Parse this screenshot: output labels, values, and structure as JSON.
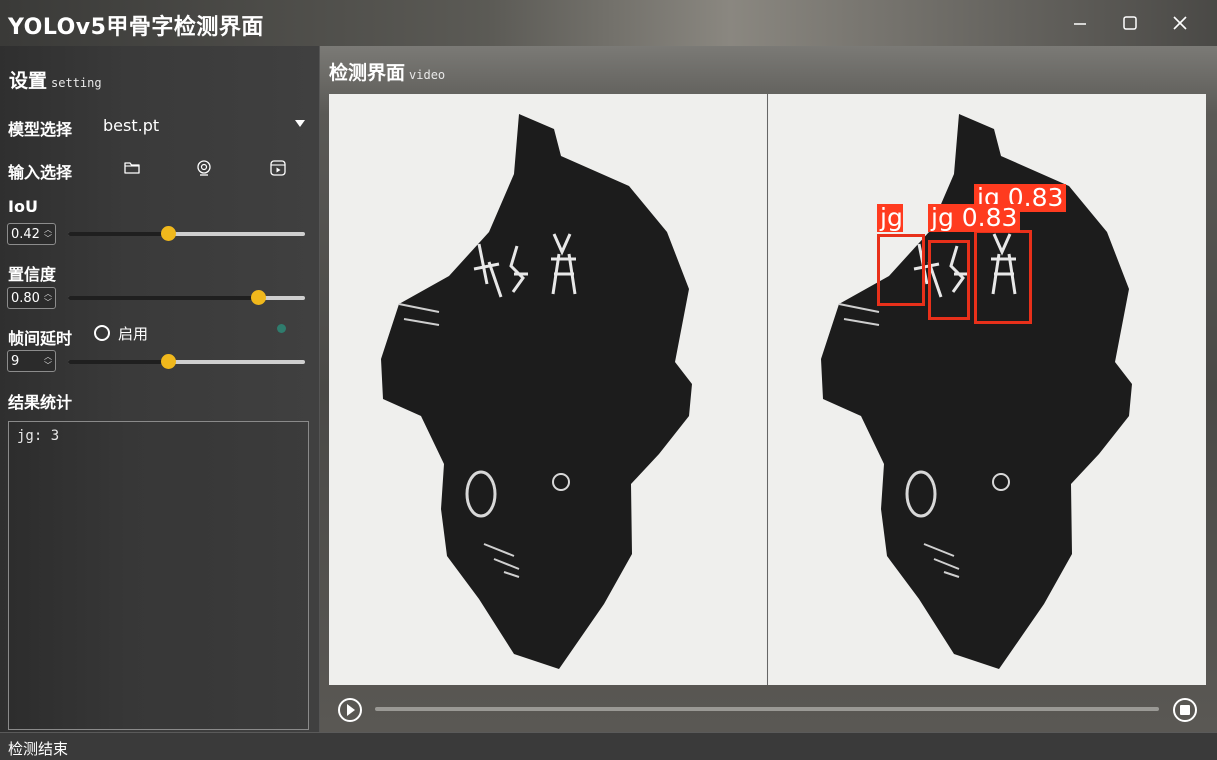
{
  "window": {
    "title": "YOLOv5甲骨字检测界面"
  },
  "settings": {
    "title": "设置",
    "subtitle": "setting",
    "model_label": "模型选择",
    "model_value": "best.pt",
    "input_label": "输入选择",
    "input_icons": [
      "folder-icon",
      "webcam-icon",
      "video-file-icon"
    ],
    "iou_label": "IoU",
    "iou_value": "0.42",
    "iou_level": 0.42,
    "conf_label": "置信度",
    "conf_value": "0.80",
    "conf_level": 0.8,
    "delay_label": "帧间延时",
    "delay_enable_label": "启用",
    "delay_value": "9",
    "delay_level": 0.42,
    "result_label": "结果统计",
    "result_text": "jg: 3"
  },
  "detection": {
    "title": "检测界面",
    "subtitle": "video",
    "detections": [
      {
        "label": "jg",
        "confidence": "0.83"
      },
      {
        "label": "jg",
        "confidence": "0.83"
      },
      {
        "label": "jg",
        "confidence": "0.83"
      }
    ],
    "box_color": "#e8301a"
  },
  "status": {
    "text": "检测结束"
  },
  "colors": {
    "accent": "#f0b81c",
    "dot": "#2f7c6d"
  }
}
